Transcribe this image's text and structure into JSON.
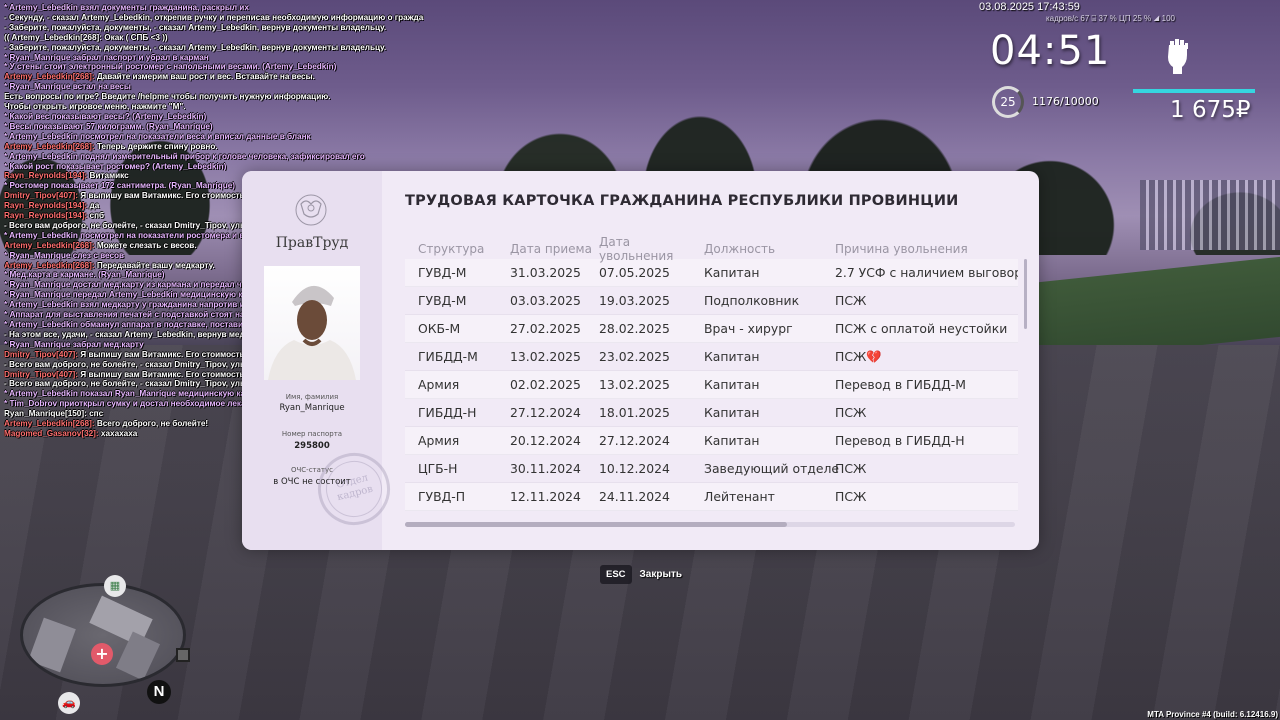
{
  "chat": [
    {
      "who": "",
      "text": "* Artemy_Lebedkin взял документы гражданина, раскрыл их",
      "style": "me"
    },
    {
      "who": "",
      "text": "- Секунду, - сказал Artemy_Lebedkin, открепив ручку и переписав необходимую информацию о гражданине в бланк.",
      "style": "sys"
    },
    {
      "who": "",
      "text": "- Заберите, пожалуйста, документы, - сказал Artemy_Lebedkin, вернув документы владельцу.",
      "style": "sys"
    },
    {
      "who": "",
      "text": "(( Artemy_Lebedkin[268]: Окак  ( СПБ <3 ))",
      "style": "sys"
    },
    {
      "who": "",
      "text": "- Заберите, пожалуйста, документы, - сказал Artemy_Lebedkin, вернув документы владельцу.",
      "style": "sys"
    },
    {
      "who": "",
      "text": "* Ryan_Manrique забрал паспорт и убрал в карман",
      "style": "me"
    },
    {
      "who": "",
      "text": "* У стены стоит электронный ростомер с напольными весами. (Artemy_Lebedkin)",
      "style": "me"
    },
    {
      "who": "Artemy_Lebedkin[268]:",
      "text": " Давайте измерим ваш рост и вес. Вставайте на весы.",
      "style": "sys"
    },
    {
      "who": "",
      "text": "* Ryan_Manrique встал на весы",
      "style": "me"
    },
    {
      "who": "",
      "text": "Есть вопросы по игре? Введите /helpme чтобы получить нужную информацию.",
      "style": "sys"
    },
    {
      "who": "",
      "text": "Чтобы открыть игровое меню, нажмите \"M\".",
      "style": "sys"
    },
    {
      "who": "",
      "text": "* Какой вес показывают весы? (Artemy_Lebedkin)",
      "style": "me"
    },
    {
      "who": "",
      "text": "* Весы показывают 57 килограмм. (Ryan_Manrique)",
      "style": "me"
    },
    {
      "who": "",
      "text": "* Artemy_Lebedkin посмотрел на показатели веса и вписал данные в бланк",
      "style": "me"
    },
    {
      "who": "Artemy_Lebedkin[268]:",
      "text": " Теперь держите спину ровно.",
      "style": "sys"
    },
    {
      "who": "",
      "text": "* Artemy_Lebedkin поднял измерительный прибор к голове человека, зафиксировал его",
      "style": "me"
    },
    {
      "who": "",
      "text": "* Какой рост показывает ростомер? (Artemy_Lebedkin)",
      "style": "me"
    },
    {
      "who": "Rayn_Reynolds[194]:",
      "text": " Витамикс",
      "style": "sys"
    },
    {
      "who": "",
      "text": "* Ростомер показывает 172 сантиметра. (Ryan_Manrique)",
      "style": "me"
    },
    {
      "who": "Dmitry_Tipov[407]:",
      "text": " Я выпишу вам Витамикс. Его стоимость 500 рублей. Вы согласны?",
      "style": "sys"
    },
    {
      "who": "Rayn_Reynolds[194]:",
      "text": " да",
      "style": "sys"
    },
    {
      "who": "Rayn_Reynolds[194]:",
      "text": " спб",
      "style": "sys"
    },
    {
      "who": "",
      "text": "- Всего вам доброго, не болейте, - сказал Dmitry_Tipov, улыбнувшись.",
      "style": "sys"
    },
    {
      "who": "",
      "text": "* Artemy_Lebedkin посмотрел на показатели ростомера и вписал данные в бланк",
      "style": "me"
    },
    {
      "who": "Artemy_Lebedkin[268]:",
      "text": " Можете слезать с весов.",
      "style": "sys"
    },
    {
      "who": "",
      "text": "* Ryan_Manrique слез с весов",
      "style": "me"
    },
    {
      "who": "Artemy_Lebedkin[268]:",
      "text": " Передавайте вашу медкарту.",
      "style": "sys"
    },
    {
      "who": "",
      "text": "* Мед.карта в кармане. (Ryan_Manrique)",
      "style": "me"
    },
    {
      "who": "",
      "text": "* Ryan_Manrique достал мед.карту из кармана и передал человеку напротив",
      "style": "me"
    },
    {
      "who": "",
      "text": "* Ryan_Manrique передал Artemy_Lebedkin медицинскую карту",
      "style": "me"
    },
    {
      "who": "",
      "text": "* Artemy_Lebedkin взял медкарту у гражданина напротив и зафиксировал данные о пациенте в бланк",
      "style": "me"
    },
    {
      "who": "",
      "text": "* Аппарат для выставления печатей с подставкой стоят на столе. (Artemy_Lebedkin)",
      "style": "me"
    },
    {
      "who": "",
      "text": "* Artemy_Lebedkin обмакнул аппарат в подставке, поставил печать",
      "style": "me"
    },
    {
      "who": "",
      "text": "- На этом все, удачи, - сказал Artemy_Lebedkin, вернув мед.карту владельцу.",
      "style": "sys"
    },
    {
      "who": "",
      "text": "* Ryan_Manrique забрал мед.карту",
      "style": "me"
    },
    {
      "who": "Dmitry_Tipov[407]:",
      "text": " Я выпишу вам Витамикс. Его стоимость 500 рублей. Вы согласны?",
      "style": "sys"
    },
    {
      "who": "",
      "text": "- Всего вам доброго, не болейте, - сказал Dmitry_Tipov, улыбнувшись.",
      "style": "sys"
    },
    {
      "who": "Dmitry_Tipov[407]:",
      "text": " Я выпишу вам Витамикс. Его стоимость 500 рублей. Вы согласны?",
      "style": "sys"
    },
    {
      "who": "",
      "text": "- Всего вам доброго, не болейте, - сказал Dmitry_Tipov, улыбнувшись.",
      "style": "sys"
    },
    {
      "who": "",
      "text": "* Artemy_Lebedkin показал Ryan_Manrique медицинскую карту",
      "style": "me"
    },
    {
      "who": "",
      "text": "* Tim_Dobrov приоткрыл сумку и достал необходимое лекарство, после чего употребил его и закрыл сумку",
      "style": "me"
    },
    {
      "who": "",
      "text": "Ryan_Manrique[150]: спс",
      "style": "sys"
    },
    {
      "who": "Artemy_Lebedkin[268]:",
      "text": " Всего доброго, не болейте!",
      "style": "sys"
    },
    {
      "who": "Magomed_Gasanov[32]:",
      "text": " хахахаха",
      "style": "sys"
    }
  ],
  "hud": {
    "datetime": "03.08.2025 17:43:59",
    "stats": "кадров/с  67    ⌸ 37 %    ЦП 25 %    ◢ 100",
    "time": "04:51",
    "level": "25",
    "xp": "1176/10000",
    "money": "1 675₽",
    "accent_color": "#35d6e0"
  },
  "card": {
    "org": "ПравТруд",
    "name_caption": "Имя, фамилия",
    "name": "Ryan_Manrique",
    "passport_caption": "Номер паспорта",
    "passport": "295800",
    "ochs_caption": "ОЧС-статус",
    "ochs": "в ОЧС не состоит",
    "stamp_line1": "Отдел",
    "stamp_line2": "кадров"
  },
  "modal": {
    "title": "ТРУДОВАЯ КАРТОЧКА ГРАЖДАНИНА РЕСПУБЛИКИ ПРОВИНЦИИ",
    "columns": [
      "Структура",
      "Дата приема",
      "Дата увольнения",
      "Должность",
      "Причина увольнения"
    ],
    "rows": [
      [
        "ГУВД-М",
        "31.03.2025",
        "07.05.2025",
        "Капитан",
        "2.7 УСФ с наличием выговора"
      ],
      [
        "ГУВД-М",
        "03.03.2025",
        "19.03.2025",
        "Подполковник",
        "ПСЖ"
      ],
      [
        "ОКБ-М",
        "27.02.2025",
        "28.02.2025",
        "Врач - хирург",
        "ПСЖ с оплатой неустойки"
      ],
      [
        "ГИБДД-М",
        "13.02.2025",
        "23.02.2025",
        "Капитан",
        "ПСЖ💔"
      ],
      [
        "Армия",
        "02.02.2025",
        "13.02.2025",
        "Капитан",
        "Перевод в ГИБДД-М"
      ],
      [
        "ГИБДД-Н",
        "27.12.2024",
        "18.01.2025",
        "Капитан",
        "ПСЖ"
      ],
      [
        "Армия",
        "20.12.2024",
        "27.12.2024",
        "Капитан",
        "Перевод в ГИБДД-Н"
      ],
      [
        "ЦГБ-Н",
        "30.11.2024",
        "10.12.2024",
        "Заведующий отделе",
        "ПСЖ"
      ],
      [
        "ГУВД-П",
        "12.11.2024",
        "24.11.2024",
        "Лейтенант",
        "ПСЖ"
      ]
    ]
  },
  "close_hint": {
    "key": "ESC",
    "label": "Закрыть"
  },
  "minimap": {
    "north": "N"
  },
  "build": "MTA Province #4 (build: 6.12416.9)"
}
